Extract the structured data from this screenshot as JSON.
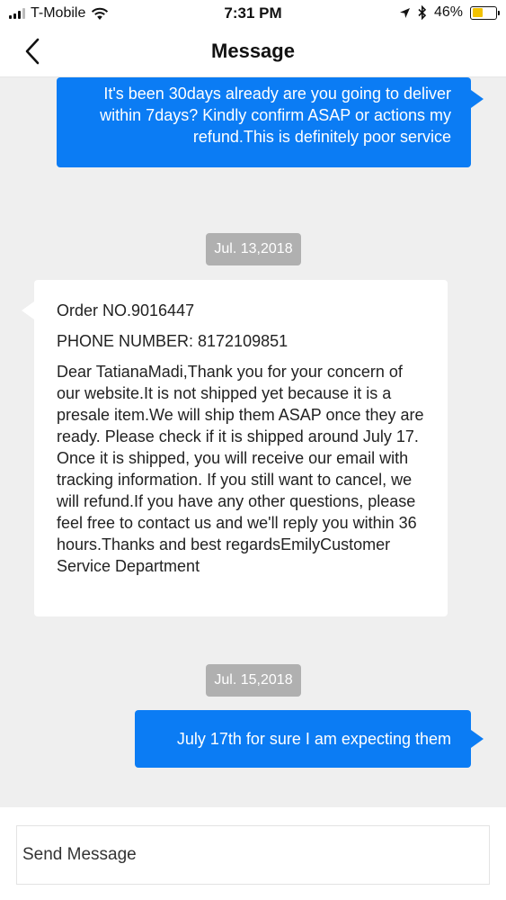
{
  "status_bar": {
    "carrier": "T-Mobile",
    "time": "7:31 PM",
    "battery_percent": "46%",
    "battery_level": 0.46,
    "icons": [
      "signal-icon",
      "wifi-icon",
      "location-arrow-icon",
      "bluetooth-icon",
      "battery-icon"
    ]
  },
  "nav": {
    "title": "Message",
    "back_icon": "chevron-left-icon"
  },
  "messages": [
    {
      "direction": "outgoing",
      "text": "It's been 30days already are you going to deliver within 7days? Kindly confirm ASAP or actions my refund.This is definitely poor service"
    },
    {
      "type": "date",
      "text": "Jul. 13,2018"
    },
    {
      "direction": "incoming",
      "order_line": "Order NO.9016447",
      "phone_line": "PHONE NUMBER: 8172109851",
      "text": "Dear TatianaMadi,Thank you for your concern of our website.It is not shipped yet because it is a presale item.We will ship them ASAP once they are ready. Please check if it is shipped around July 17. Once it is shipped, you will receive our email with tracking information. If you still want to cancel, we will refund.If you have any other questions, please feel free to contact us and we'll reply you within 36 hours.Thanks and best regardsEmilyCustomer Service Department"
    },
    {
      "type": "date",
      "text": "Jul. 15,2018"
    },
    {
      "direction": "outgoing",
      "text": "July 17th for sure I am expecting them"
    }
  ],
  "composer": {
    "placeholder": "Send Message",
    "value": ""
  },
  "colors": {
    "outgoing_bubble": "#0b7cf4",
    "incoming_bubble": "#ffffff",
    "chat_background": "#efefef",
    "date_pill": "#b0b0b0",
    "battery_fill": "#f2c200"
  }
}
